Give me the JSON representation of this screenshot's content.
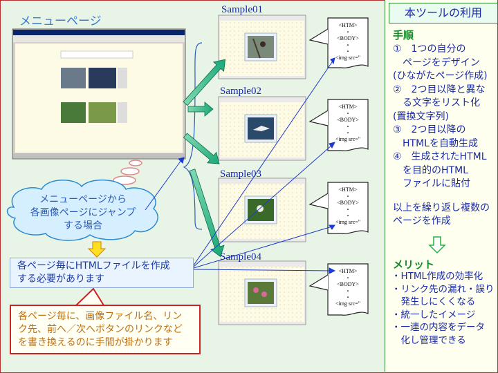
{
  "menu": {
    "title": "メニューページ"
  },
  "samples": [
    {
      "label": "Sample01"
    },
    {
      "label": "Sample02"
    },
    {
      "label": "Sample03"
    },
    {
      "label": "Sample04"
    }
  ],
  "code_doc": {
    "line1": "<HTM>",
    "dot": "・",
    "line2": "<BODY>",
    "line3": "<img src=\""
  },
  "cloud": {
    "line1": "メニューページから",
    "line2": "各画像ページにジャンプ",
    "line3": "する場合"
  },
  "info_box": {
    "line1": "各ページ毎にHTMLファイルを作成",
    "line2": "する必要があります"
  },
  "warning_box": {
    "line1": "各ページ毎に、画像ファイル名、リン",
    "line2": "ク先、前へ／次へボタンのリンクなど",
    "line3": "を書き換えるのに手間が掛かります"
  },
  "panel": {
    "title": "本ツールの利用",
    "steps_heading": "手順",
    "steps": [
      "①　1つの自分の",
      "　ページをデザイン",
      "(ひながたページ作成)",
      "②　2つ目以降と異な",
      "　る文字をリスト化",
      "(置換文字列)",
      "③　2つ目以降の",
      "　HTMLを自動生成",
      "④　生成されたHTML",
      "　を目的のHTML",
      "　ファイルに貼付"
    ],
    "repeat": [
      "以上を繰り返し複数の",
      "ページを作成"
    ],
    "merit_heading": "メリット",
    "merits": [
      "・HTML作成の効率化",
      "・リンク先の漏れ・誤り",
      "　発生しにくくなる",
      "・統一したイメージ",
      "・一連の内容をデータ",
      "　化し管理できる"
    ]
  },
  "colors": {
    "accent_blue": "#1a2aa8",
    "arrow_green": "#1aa878",
    "warning_red": "#d02020",
    "panel_green": "#138a2a"
  }
}
